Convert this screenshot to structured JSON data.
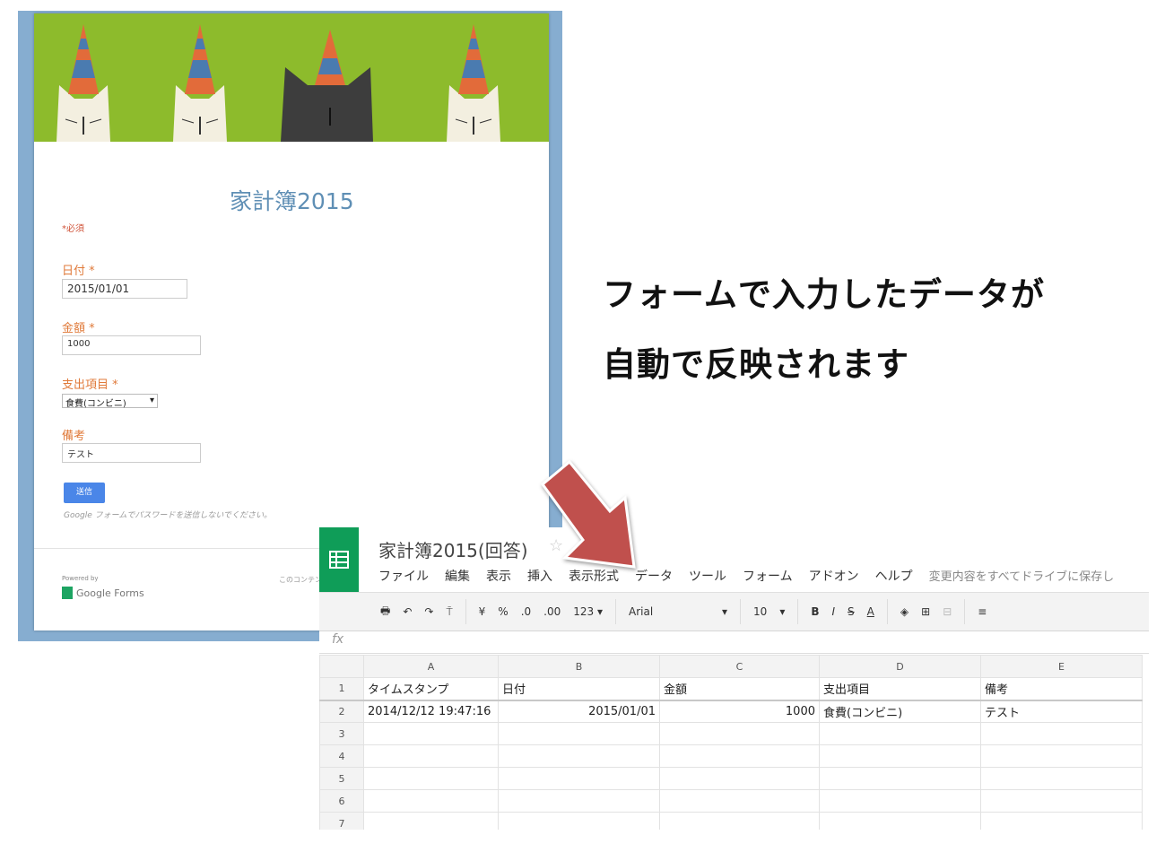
{
  "form": {
    "title": "家計簿2015",
    "required_note": "*必須",
    "fields": [
      {
        "label": "日付 *",
        "value": "2015/01/01"
      },
      {
        "label": "金額 *",
        "value": "1000"
      },
      {
        "label": "支出項目 *",
        "value": "食費(コンビニ)"
      },
      {
        "label": "備考",
        "value": "テスト"
      }
    ],
    "submit_label": "送信",
    "password_note": "Google フォームでパスワードを送信しないでください。",
    "powered_by": "Powered by",
    "brand": "Google Forms",
    "content_note": "このコンテンツ"
  },
  "caption": {
    "line1": "フォームで入力したデータが",
    "line2": "自動で反映されます"
  },
  "sheet": {
    "title": "家計簿2015(回答)",
    "menu": [
      "ファイル",
      "編集",
      "表示",
      "挿入",
      "表示形式",
      "データ",
      "ツール",
      "フォーム",
      "アドオン",
      "ヘルプ"
    ],
    "saved_status": "変更内容をすべてドライブに保存し",
    "toolbar": {
      "currency": "¥",
      "percent": "%",
      "dec_less": ".0",
      "dec_more": ".00",
      "format": "123 ▾",
      "font": "Arial",
      "size": "10",
      "bold": "B",
      "italic": "I",
      "strike": "S",
      "color": "A"
    },
    "fx": "fx",
    "columns": [
      "A",
      "B",
      "C",
      "D",
      "E"
    ],
    "rows": [
      {
        "n": "1",
        "cells": [
          "タイムスタンプ",
          "日付",
          "金額",
          "支出項目",
          "備考"
        ]
      },
      {
        "n": "2",
        "cells": [
          "2014/12/12 19:47:16",
          "2015/01/01",
          "1000",
          "食費(コンビニ)",
          "テスト"
        ]
      },
      {
        "n": "3",
        "cells": [
          "",
          "",
          "",
          "",
          ""
        ]
      },
      {
        "n": "4",
        "cells": [
          "",
          "",
          "",
          "",
          ""
        ]
      },
      {
        "n": "5",
        "cells": [
          "",
          "",
          "",
          "",
          ""
        ]
      },
      {
        "n": "6",
        "cells": [
          "",
          "",
          "",
          "",
          ""
        ]
      },
      {
        "n": "7",
        "cells": [
          "",
          "",
          "",
          "",
          ""
        ]
      }
    ]
  },
  "colors": {
    "sheets_green": "#0f9d58",
    "arrow": "#c0504d",
    "banner": "#8dbb2c",
    "label": "#e07a3a"
  }
}
